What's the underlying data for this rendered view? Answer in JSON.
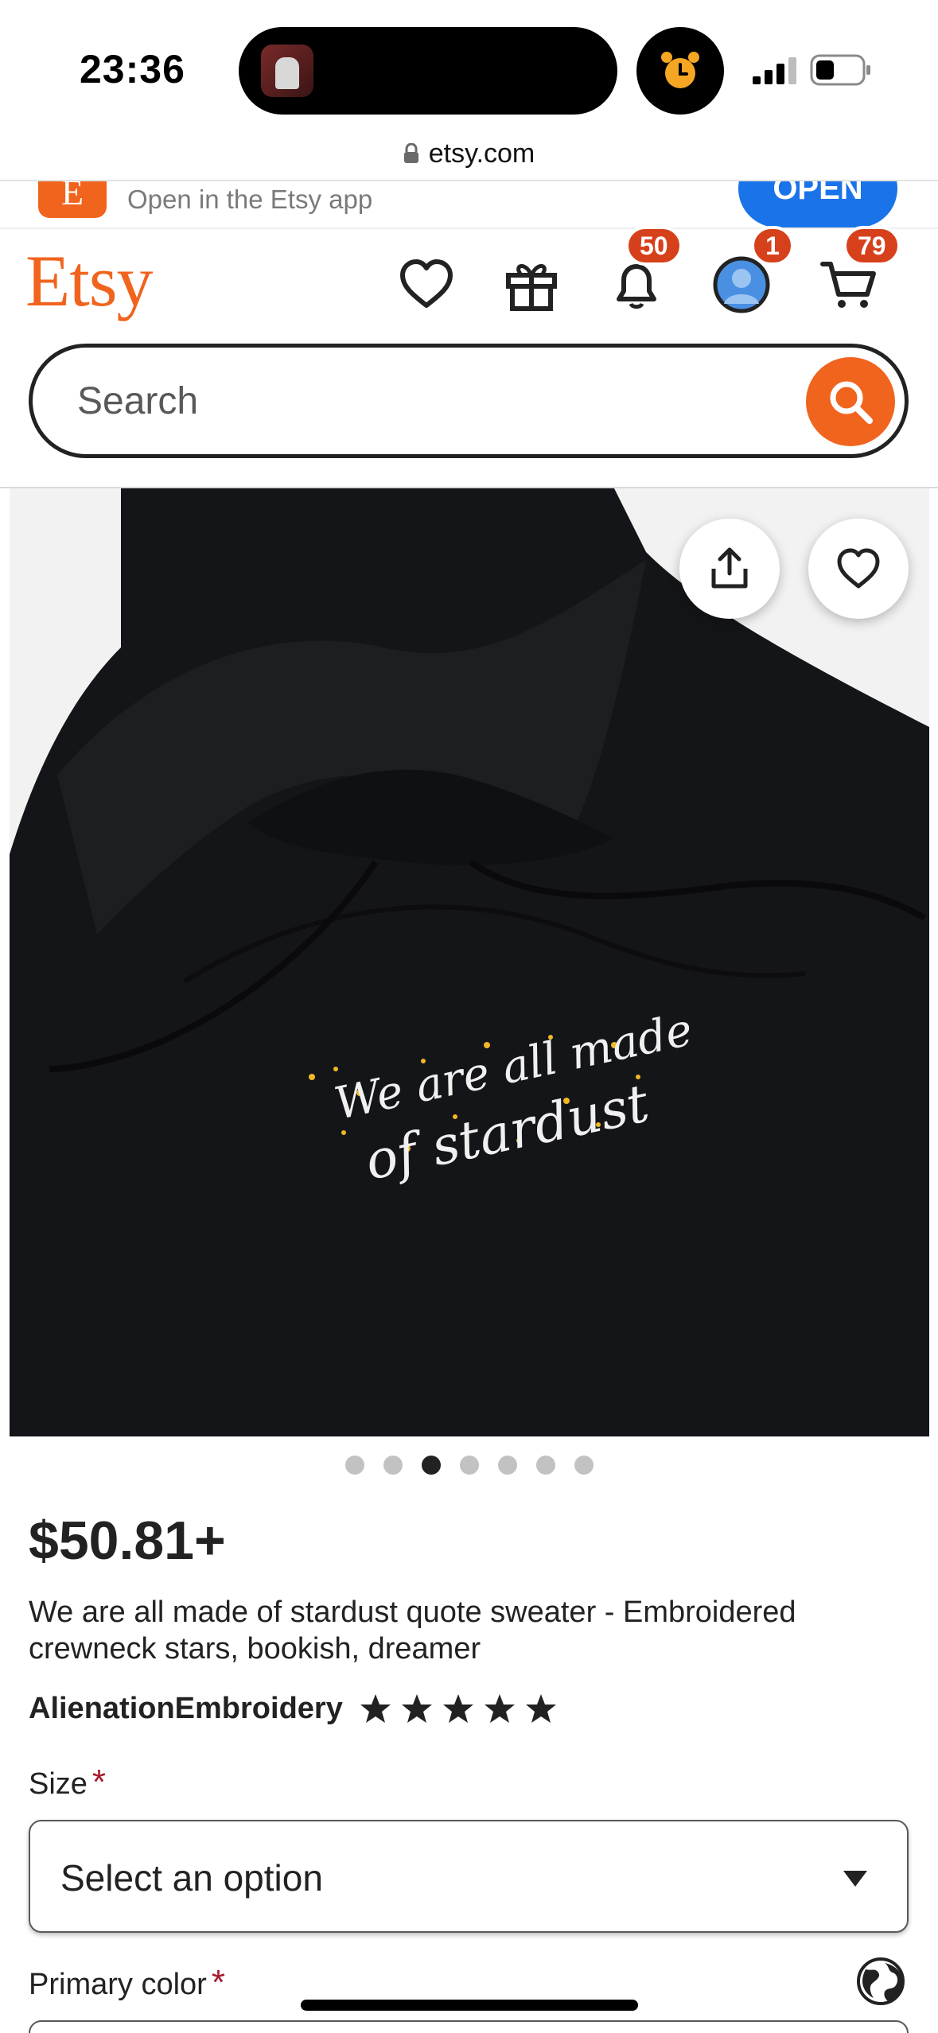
{
  "status_bar": {
    "time": "23:36"
  },
  "browser": {
    "url": "etsy.com"
  },
  "app_banner": {
    "logo_letter": "E",
    "text": "Open in the Etsy app",
    "button": "OPEN"
  },
  "header": {
    "logo": "Etsy",
    "badges": {
      "notifications": "50",
      "account": "1",
      "cart": "79"
    }
  },
  "search": {
    "placeholder": "Search"
  },
  "gallery": {
    "slide_count": 7,
    "active_index": 2
  },
  "image_text": {
    "line1": "We are all made",
    "line2": "of stardust"
  },
  "listing": {
    "price": "$50.81+",
    "title": "We are all made of stardust quote sweater - Embroidered crewneck stars, bookish, dreamer",
    "shop_name": "AlienationEmbroidery",
    "rating": 5
  },
  "options": {
    "size_label": "Size",
    "size_value": "Select an option",
    "color_label": "Primary color",
    "required_mark": "*"
  },
  "colors": {
    "etsy_orange": "#f1641e",
    "badge_red": "#d6401a",
    "required_red": "#a61a2e",
    "open_blue": "#1a73e8"
  },
  "icons": [
    "lock-icon",
    "heart-icon",
    "gift-icon",
    "bell-icon",
    "avatar-icon",
    "cart-icon",
    "search-icon",
    "share-icon",
    "favorite-icon",
    "star-icon",
    "globe-icon",
    "alarm-icon",
    "signal-icon",
    "battery-icon"
  ]
}
